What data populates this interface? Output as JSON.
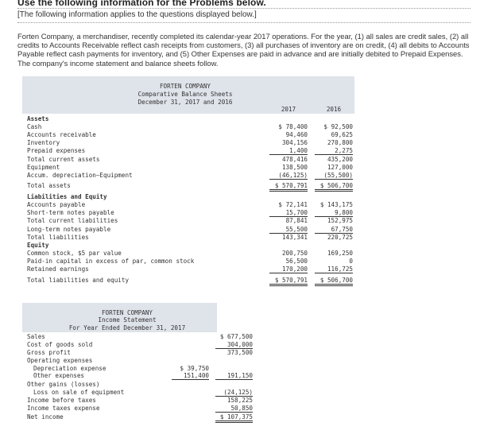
{
  "heading": "Use the following information for the Problems below.",
  "subheading": "[The following information applies to the questions displayed below.]",
  "intro": "Forten Company, a merchandiser, recently completed its calendar-year 2017 operations. For the year, (1) all sales are credit sales, (2) all credits to Accounts Receivable reflect cash receipts from customers, (3) all purchases of inventory are on credit, (4) all debits to Accounts Payable reflect cash payments for inventory, and (5) Other Expenses are paid in advance and are initially debited to Prepaid Expenses. The company's income statement and balance sheets follow.",
  "balance_sheet": {
    "company": "FORTEN COMPANY",
    "title": "Comparative Balance Sheets",
    "date": "December 31, 2017 and 2016",
    "col_2017": "2017",
    "col_2016": "2016",
    "rows": [
      {
        "label": "Assets",
        "v17": "",
        "v16": ""
      },
      {
        "label": "Cash",
        "v17": "$ 78,400",
        "v16": "$ 92,500"
      },
      {
        "label": "Accounts receivable",
        "v17": "94,460",
        "v16": "69,625"
      },
      {
        "label": "Inventory",
        "v17": "304,156",
        "v16": "270,800"
      },
      {
        "label": "Prepaid expenses",
        "v17": "1,400",
        "v16": "2,275"
      },
      {
        "label": "Total current assets",
        "v17": "478,416",
        "v16": "435,200"
      },
      {
        "label": "Equipment",
        "v17": "138,500",
        "v16": "127,000"
      },
      {
        "label": "Accum. depreciation—Equipment",
        "v17": "(46,125)",
        "v16": "(55,500)"
      },
      {
        "label": "Total assets",
        "v17": "$ 570,791",
        "v16": "$ 506,700"
      },
      {
        "label": "Liabilities and Equity",
        "v17": "",
        "v16": ""
      },
      {
        "label": "Accounts payable",
        "v17": "$ 72,141",
        "v16": "$ 143,175"
      },
      {
        "label": "Short-term notes payable",
        "v17": "15,700",
        "v16": "9,800"
      },
      {
        "label": "Total current liabilities",
        "v17": "87,841",
        "v16": "152,975"
      },
      {
        "label": "Long-term notes payable",
        "v17": "55,500",
        "v16": "67,750"
      },
      {
        "label": "Total liabilities",
        "v17": "143,341",
        "v16": "220,725"
      },
      {
        "label": "Equity",
        "v17": "",
        "v16": ""
      },
      {
        "label": "Common stock, $5 par value",
        "v17": "200,750",
        "v16": "169,250"
      },
      {
        "label": "Paid-in capital in excess of par, common stock",
        "v17": "56,500",
        "v16": "0"
      },
      {
        "label": "Retained earnings",
        "v17": "170,200",
        "v16": "116,725"
      },
      {
        "label": "Total liabilities and equity",
        "v17": "$ 570,791",
        "v16": "$ 506,700"
      }
    ]
  },
  "income_statement": {
    "company": "FORTEN COMPANY",
    "title": "Income Statement",
    "date": "For Year Ended December 31, 2017",
    "rows": [
      {
        "label": "Sales",
        "inner": "",
        "outer": "$ 677,500"
      },
      {
        "label": "Cost of goods sold",
        "inner": "",
        "outer": "304,000"
      },
      {
        "label": "Gross profit",
        "inner": "",
        "outer": "373,500"
      },
      {
        "label": "Operating expenses",
        "inner": "",
        "outer": ""
      },
      {
        "label": "Depreciation expense",
        "inner": "$ 39,750",
        "outer": ""
      },
      {
        "label": "Other expenses",
        "inner": "151,400",
        "outer": "191,150"
      },
      {
        "label": "Other gains (losses)",
        "inner": "",
        "outer": ""
      },
      {
        "label": "Loss on sale of equipment",
        "inner": "",
        "outer": "(24,125)"
      },
      {
        "label": "Income before taxes",
        "inner": "",
        "outer": "158,225"
      },
      {
        "label": "Income taxes expense",
        "inner": "",
        "outer": "50,850"
      },
      {
        "label": "Net income",
        "inner": "",
        "outer": "$ 107,375"
      }
    ]
  }
}
